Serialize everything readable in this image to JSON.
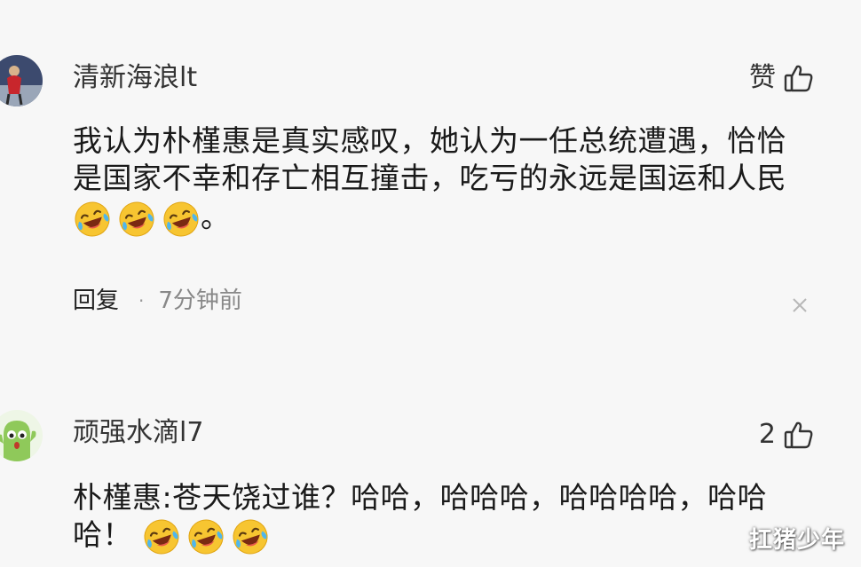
{
  "comments": [
    {
      "username": "清新海浪lt",
      "like_label": "赞",
      "text_line1": "我认为朴槿惠是真实感叹，她认为一任总统遭遇，恰恰",
      "text_line2": "是国家不幸和存亡相互撞击，吃亏的永远是国运和人民",
      "text_tail": "。",
      "emoji_name": "laughing-crying-emoji",
      "emoji_count": 3,
      "reply_label": "回复",
      "separator": "·",
      "time": "7分钟前"
    },
    {
      "username": "顽强水滴l7",
      "like_label": "2",
      "text_line1": "朴槿惠:苍天饶过谁？哈哈，哈哈哈，哈哈哈哈，哈哈",
      "text_line2": "哈！",
      "emoji_name": "laughing-crying-emoji",
      "emoji_count": 3
    }
  ],
  "watermark": "扛猪少年",
  "colors": {
    "background": "#f7f7f7",
    "text": "#1a1a1a",
    "meta": "#888888",
    "emoji_face": "#f7c531"
  },
  "icons": [
    "thumbs-up-icon",
    "close-icon",
    "avatar"
  ]
}
